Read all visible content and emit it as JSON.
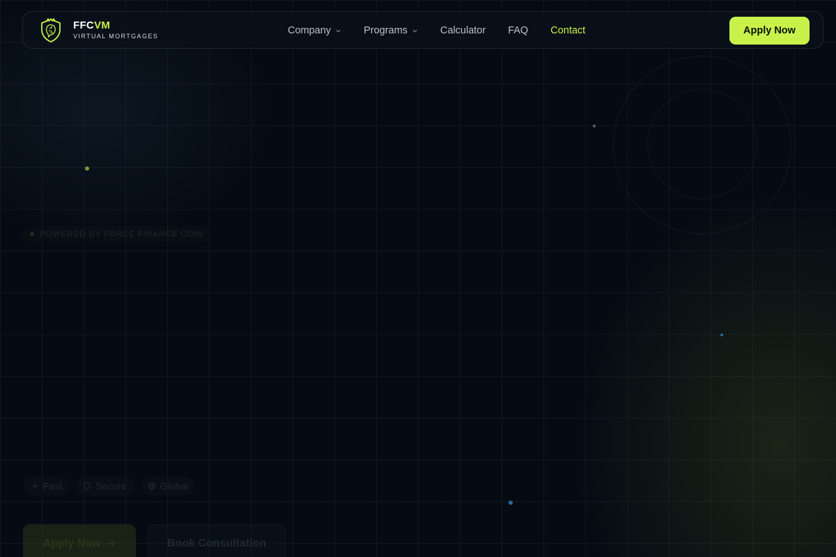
{
  "brand": {
    "name_first": "FFC",
    "name_second": "VM",
    "tagline": "VIRTUAL MORTGAGES",
    "logo_icon": "lion-shield-icon",
    "accent_color": "#c8f24a"
  },
  "nav": {
    "items": [
      {
        "label": "Company",
        "has_dropdown": true
      },
      {
        "label": "Programs",
        "has_dropdown": true
      },
      {
        "label": "Calculator",
        "has_dropdown": false
      },
      {
        "label": "FAQ",
        "has_dropdown": false
      },
      {
        "label": "Contact",
        "has_dropdown": false,
        "active": true
      }
    ],
    "cta_label": "Apply Now"
  },
  "hero": {
    "badge_text": "POWERED BY FORCE FINANCE COIN",
    "features": [
      {
        "label": "Fast",
        "icon": "lightning-icon"
      },
      {
        "label": "Secure",
        "icon": "shield-icon"
      },
      {
        "label": "Global",
        "icon": "globe-icon"
      }
    ],
    "primary_cta": "Apply Now",
    "primary_cta_icon": "arrow-right-icon",
    "secondary_cta": "Book Consultation"
  }
}
